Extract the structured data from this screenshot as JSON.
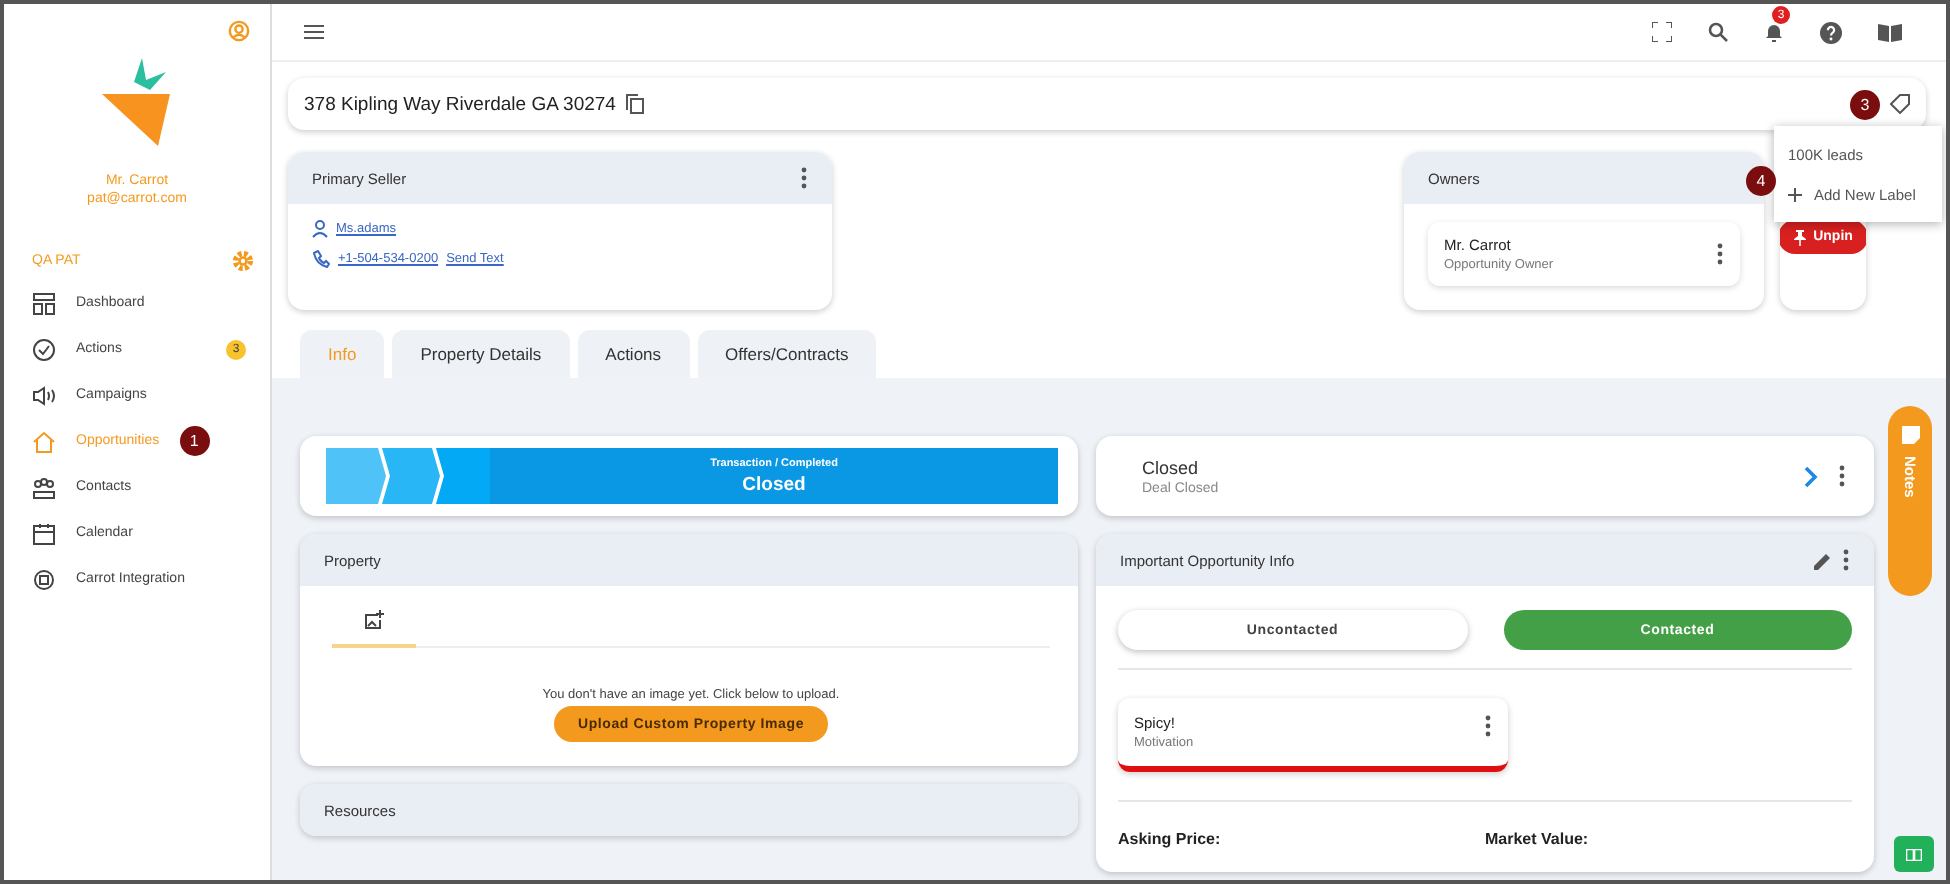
{
  "sidebar": {
    "user_name": "Mr. Carrot",
    "user_email": "pat@carrot.com",
    "account": "QA PAT",
    "items": [
      {
        "label": "Dashboard",
        "kind": "dashboard",
        "selected": false
      },
      {
        "label": "Actions",
        "kind": "actions",
        "selected": false,
        "badge": "3"
      },
      {
        "label": "Campaigns",
        "kind": "campaigns",
        "selected": false
      },
      {
        "label": "Opportunities",
        "kind": "home",
        "selected": true,
        "callout": "1"
      },
      {
        "label": "Contacts",
        "kind": "contacts",
        "selected": false
      },
      {
        "label": "Calendar",
        "kind": "calendar",
        "selected": false
      },
      {
        "label": "Carrot Integration",
        "kind": "integration",
        "selected": false
      }
    ]
  },
  "header": {
    "notification_count": "3"
  },
  "address": {
    "text": "378 Kipling Way Riverdale GA 30274",
    "tag_callout": "3"
  },
  "label_menu": {
    "items": [
      {
        "label": "100K leads",
        "kind": "label"
      },
      {
        "label": "Add New Label",
        "kind": "add",
        "callout": "4"
      }
    ]
  },
  "primary_seller": {
    "title": "Primary Seller",
    "name": "Ms.adams",
    "phone": "+1-504-534-0200",
    "send_text": "Send Text"
  },
  "owners": {
    "title": "Owners",
    "owner_name": "Mr. Carrot",
    "owner_role": "Opportunity Owner"
  },
  "pin_button": "Unpin",
  "tabs": [
    {
      "label": "Info",
      "selected": true
    },
    {
      "label": "Property Details",
      "selected": false
    },
    {
      "label": "Actions",
      "selected": false
    },
    {
      "label": "Offers/Contracts",
      "selected": false
    }
  ],
  "stage": {
    "caption": "Transaction / Completed",
    "label": "Closed"
  },
  "status_card": {
    "title": "Closed",
    "subtitle": "Deal Closed"
  },
  "property": {
    "title": "Property",
    "empty_text": "You don't have an image yet. Click below to upload.",
    "upload_button": "Upload Custom Property Image"
  },
  "resources": {
    "title": "Resources"
  },
  "opportunity_info": {
    "title": "Important Opportunity Info",
    "contact_options": [
      {
        "label": "Uncontacted",
        "selected": false
      },
      {
        "label": "Contacted",
        "selected": true
      }
    ],
    "motivation": {
      "value": "Spicy!",
      "label": "Motivation"
    },
    "fields": [
      {
        "label": "Asking Price:"
      },
      {
        "label": "Market Value:"
      }
    ]
  },
  "notes_tab": "Notes"
}
